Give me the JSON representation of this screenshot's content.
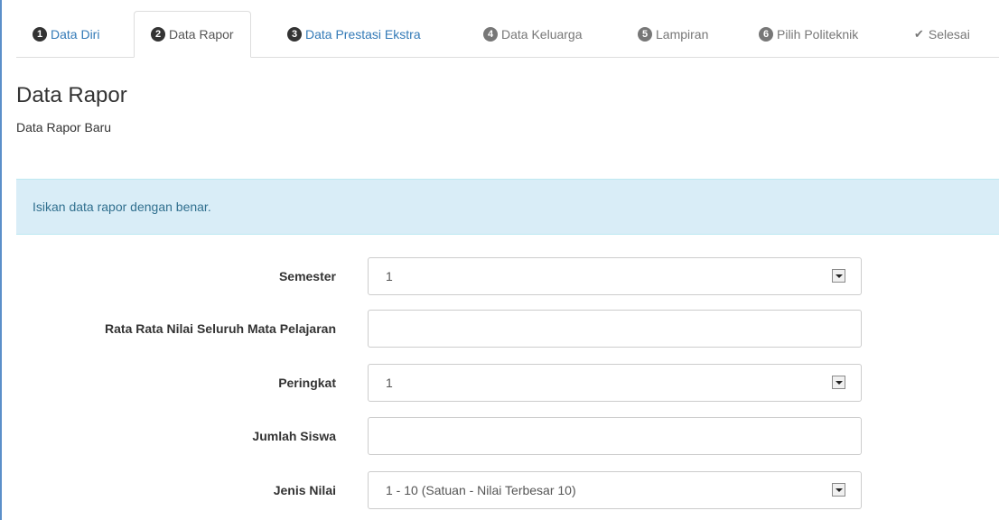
{
  "tabs": [
    {
      "num": "1",
      "label": "Data Diri",
      "state": "done"
    },
    {
      "num": "2",
      "label": "Data Rapor",
      "state": "active"
    },
    {
      "num": "3",
      "label": "Data Prestasi Ekstra",
      "state": "done"
    },
    {
      "num": "4",
      "label": "Data Keluarga",
      "state": "pending"
    },
    {
      "num": "5",
      "label": "Lampiran",
      "state": "pending"
    },
    {
      "num": "6",
      "label": "Pilih Politeknik",
      "state": "pending"
    },
    {
      "num": "",
      "label": "Selesai",
      "state": "pending",
      "icon": "check-icon"
    }
  ],
  "page": {
    "title": "Data Rapor",
    "subtitle": "Data Rapor Baru",
    "alert": "Isikan data rapor dengan benar."
  },
  "form": {
    "semester": {
      "label": "Semester",
      "value": "1"
    },
    "rata_rata": {
      "label": "Rata Rata Nilai Seluruh Mata Pelajaran",
      "value": ""
    },
    "peringkat": {
      "label": "Peringkat",
      "value": "1"
    },
    "jumlah_siswa": {
      "label": "Jumlah Siswa",
      "value": ""
    },
    "jenis_nilai": {
      "label": "Jenis Nilai",
      "value": "1 - 10 (Satuan - Nilai Terbesar 10)"
    }
  },
  "colors": {
    "link": "#337ab7",
    "alert_bg": "#d9edf7",
    "alert_text": "#31708f",
    "frame": "#5b8fc9"
  }
}
